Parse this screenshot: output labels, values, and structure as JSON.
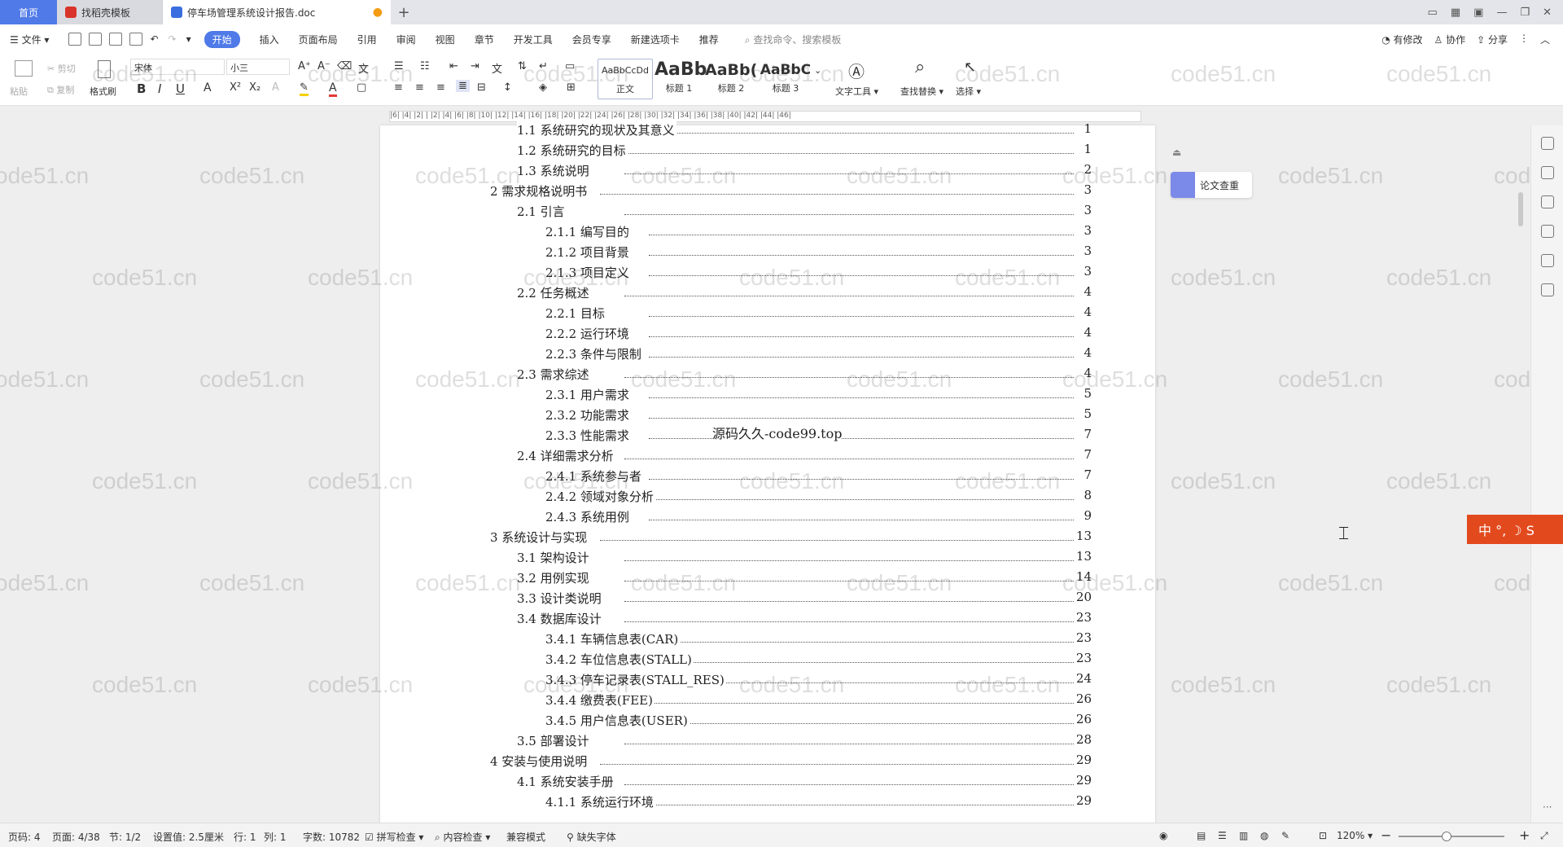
{
  "tabs": {
    "home": "首页",
    "template": "找稻壳模板",
    "document": "停车场管理系统设计报告.doc"
  },
  "menu": {
    "file": "文件",
    "items": [
      "开始",
      "插入",
      "页面布局",
      "引用",
      "审阅",
      "视图",
      "章节",
      "开发工具",
      "会员专享",
      "新建选项卡",
      "推荐"
    ],
    "search_placeholder": "查找命令、搜索模板",
    "has_changes": "有修改",
    "collaborate": "协作",
    "share": "分享"
  },
  "ribbon": {
    "paste": "粘贴",
    "cut": "剪切",
    "copy": "复制",
    "format_painter": "格式刷",
    "font_name": "宋体",
    "font_size": "小三",
    "styles": [
      {
        "preview": "AaBbCcDd",
        "label": "正文"
      },
      {
        "preview": "AaBb",
        "label": "标题 1"
      },
      {
        "preview": "AaBb(",
        "label": "标题 2"
      },
      {
        "preview": "AaBbC",
        "label": "标题 3"
      }
    ],
    "text_tools": "文字工具",
    "find_replace": "查找替换",
    "select": "选择"
  },
  "ruler_marks": "|6| |4| |2| | |2| |4| |6| |8| |10| |12| |14| |16| |18| |20| |22| |24| |26| |28| |30| |32| |34| |36| |38| |40| |42| |44| |46|",
  "toc": [
    {
      "level": 2,
      "label": "1.1 系统研究的现状及其意义",
      "page": "1"
    },
    {
      "level": 2,
      "label": "1.2 系统研究的目标",
      "page": "1"
    },
    {
      "level": 2,
      "label": "1.3 系统说明",
      "page": "2"
    },
    {
      "level": 1,
      "label": "2 需求规格说明书",
      "page": "3"
    },
    {
      "level": 2,
      "label": "2.1 引言",
      "page": "3"
    },
    {
      "level": 3,
      "label": "2.1.1 编写目的",
      "page": "3"
    },
    {
      "level": 3,
      "label": "2.1.2 项目背景",
      "page": "3"
    },
    {
      "level": 3,
      "label": "2.1.3 项目定义",
      "page": "3"
    },
    {
      "level": 2,
      "label": "2.2 任务概述",
      "page": "4"
    },
    {
      "level": 3,
      "label": "2.2.1 目标",
      "page": "4"
    },
    {
      "level": 3,
      "label": "2.2.2 运行环境",
      "page": "4"
    },
    {
      "level": 3,
      "label": "2.2.3 条件与限制",
      "page": "4"
    },
    {
      "level": 2,
      "label": "2.3 需求综述",
      "page": "4"
    },
    {
      "level": 3,
      "label": "2.3.1 用户需求",
      "page": "5"
    },
    {
      "level": 3,
      "label": "2.3.2 功能需求",
      "page": "5"
    },
    {
      "level": 3,
      "label": "2.3.3 性能需求",
      "page": "7"
    },
    {
      "level": 2,
      "label": "2.4 详细需求分析",
      "page": "7"
    },
    {
      "level": 3,
      "label": "2.4.1 系统参与者",
      "page": "7"
    },
    {
      "level": 3,
      "label": "2.4.2 领域对象分析",
      "page": "8"
    },
    {
      "level": 3,
      "label": "2.4.3 系统用例",
      "page": "9"
    },
    {
      "level": 1,
      "label": "3 系统设计与实现",
      "page": "13"
    },
    {
      "level": 2,
      "label": "3.1 架构设计",
      "page": "13"
    },
    {
      "level": 2,
      "label": "3.2 用例实现",
      "page": "14"
    },
    {
      "level": 2,
      "label": "3.3 设计类说明",
      "page": "20"
    },
    {
      "level": 2,
      "label": "3.4 数据库设计",
      "page": "23"
    },
    {
      "level": 3,
      "label": "3.4.1 车辆信息表(CAR)",
      "page": "23"
    },
    {
      "level": 3,
      "label": "3.4.2 车位信息表(STALL)",
      "page": "23"
    },
    {
      "level": 3,
      "label": "3.4.3 停车记录表(STALL_RES)",
      "page": "24"
    },
    {
      "level": 3,
      "label": "3.4.4 缴费表(FEE)",
      "page": "26"
    },
    {
      "level": 3,
      "label": "3.4.5 用户信息表(USER)",
      "page": "26"
    },
    {
      "level": 2,
      "label": "3.5 部署设计",
      "page": "28"
    },
    {
      "level": 1,
      "label": "4 安装与使用说明",
      "page": "29"
    },
    {
      "level": 2,
      "label": "4.1 系统安装手册",
      "page": "29"
    },
    {
      "level": 3,
      "label": "4.1.1 系统运行环境",
      "page": "29"
    }
  ],
  "overlay_text": "源码久久-code99.top",
  "watermark": "code51.cn",
  "side_panel": {
    "plagiarism_check": "论文查重"
  },
  "ime": {
    "label": "中 °, ☽ S"
  },
  "status": {
    "page_code": "页码: 4",
    "page": "页面: 4/38",
    "section": "节: 1/2",
    "setting": "设置值: 2.5厘米",
    "row": "行: 1",
    "col": "列: 1",
    "words": "字数: 10782",
    "spell_check": "拼写检查",
    "content_check": "内容检查",
    "compat_mode": "兼容模式",
    "missing_fonts": "缺失字体",
    "zoom": "120%",
    "zoom_fraction": 0.45
  }
}
